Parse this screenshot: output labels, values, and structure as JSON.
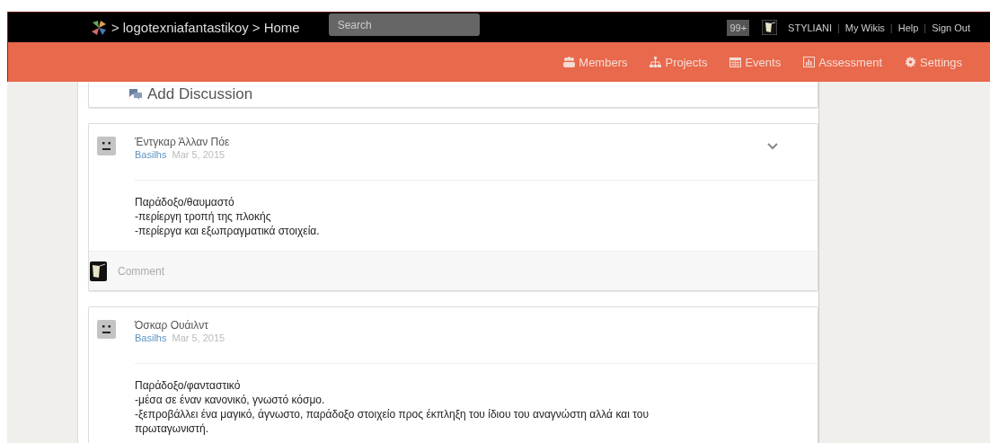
{
  "top_bar": {
    "breadcrumb": [
      {
        "label": "logotexniafantastikoy"
      },
      {
        "label": "Home"
      }
    ],
    "separator": ">",
    "search": {
      "placeholder": "Search"
    },
    "notification_badge": "99+",
    "user_links": [
      "STYLIANI",
      "My Wikis",
      "Help",
      "Sign Out"
    ],
    "link_separator": "|"
  },
  "nav": [
    {
      "kind": "members",
      "label": "Members"
    },
    {
      "kind": "projects",
      "label": "Projects"
    },
    {
      "kind": "events",
      "label": "Events"
    },
    {
      "kind": "assessment",
      "label": "Assessment"
    },
    {
      "kind": "settings",
      "label": "Settings"
    }
  ],
  "add_discussion": {
    "label": "Add Discussion"
  },
  "discussions": [
    {
      "title": "Έντγκαρ Άλλαν Πόε",
      "author": "Basilhs",
      "date": "Mar 5, 2015",
      "menu_toggle": true,
      "body": [
        "Παράδοξο/θαυμαστό",
        "-περίεργη τροπή της πλοκής",
        "-περίεργα και εξωπραγματικά στοιχεία."
      ],
      "comment": {
        "placeholder": "Comment"
      }
    },
    {
      "title": "Όσκαρ Ουάιλντ",
      "author": "Basilhs",
      "date": "Mar 5, 2015",
      "menu_toggle": false,
      "body": [
        "Παράδοξο/φανταστικό",
        "-μέσα σε έναν κανονικό, γνωστό κόσμο.",
        "-ξεπροβάλλει ένα μαγικό, άγνωστο, παράδοξο στοιχείο προς έκπληξη του ίδιου του αναγνώστη αλλά και του πρωταγωνιστή."
      ]
    }
  ]
}
